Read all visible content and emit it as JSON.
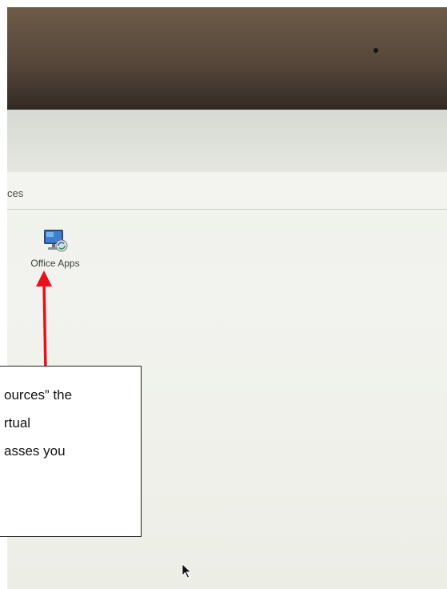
{
  "screen": {
    "header_text": "ces",
    "app_tile": {
      "label": "Office Apps",
      "icon": "remote-desktop-monitor-icon"
    },
    "cursor_icon": "mouse-pointer-icon"
  },
  "callout": {
    "lines": [
      "ources” the",
      "rtual",
      "asses you"
    ],
    "arrow_color": "#e8101a"
  }
}
